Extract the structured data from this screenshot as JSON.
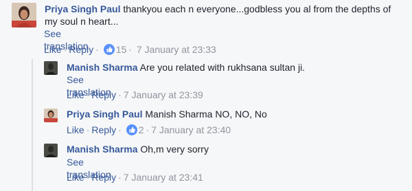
{
  "colors": {
    "link": "#365899",
    "meta": "#90949c",
    "text": "#1d2129",
    "like_badge": "#5890ff",
    "background": "#f6f7f9"
  },
  "comments": [
    {
      "author": "Priya Singh Paul",
      "text": "thankyou each n everyone...godbless you al from the depths of my soul n heart...",
      "see_translation": "See translation",
      "like_label": "Like",
      "reply_label": "Reply",
      "like_count": "15",
      "timestamp": "7 January at 23:33"
    },
    {
      "author": "Manish Sharma",
      "text": "Are you related with rukhsana sultan ji.",
      "see_translation": "See translation",
      "like_label": "Like",
      "reply_label": "Reply",
      "timestamp": "7 January at 23:39"
    },
    {
      "author": "Priya Singh Paul",
      "tagged": "Manish Sharma",
      "text": "NO, NO, No",
      "like_label": "Like",
      "reply_label": "Reply",
      "like_count": "2",
      "timestamp": "7 January at 23:40"
    },
    {
      "author": "Manish Sharma",
      "text": "Oh,m very sorry",
      "see_translation": "See translation",
      "like_label": "Like",
      "reply_label": "Reply",
      "timestamp": "7 January at 23:41"
    }
  ],
  "icons": {
    "like_badge": "thumbs-up-icon",
    "avatar_priya": "avatar",
    "avatar_manish": "avatar"
  }
}
